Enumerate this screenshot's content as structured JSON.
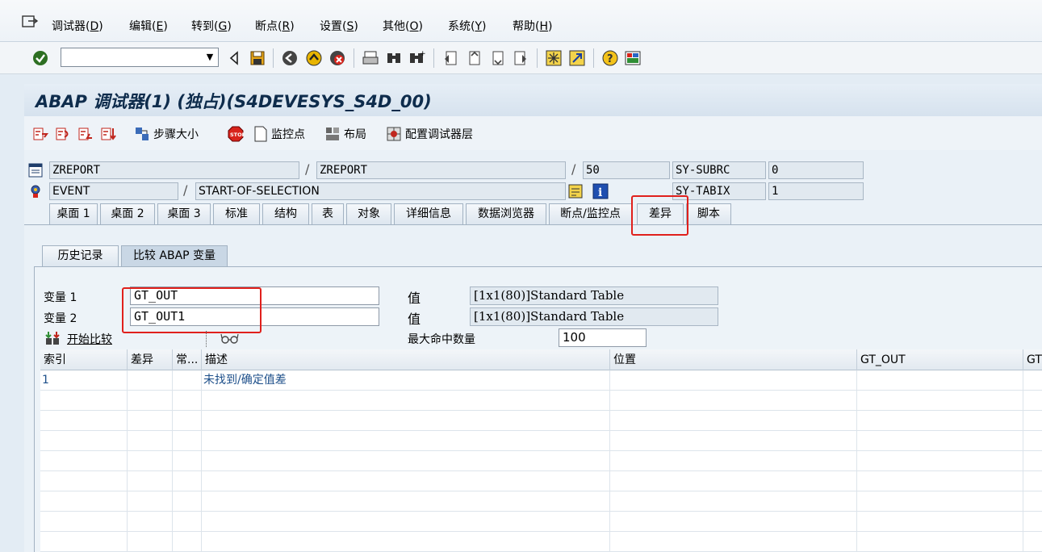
{
  "menu": [
    {
      "label": "调试器(",
      "key": "D",
      "suffix": ")"
    },
    {
      "label": "编辑(",
      "key": "E",
      "suffix": ")"
    },
    {
      "label": "转到(",
      "key": "G",
      "suffix": ")"
    },
    {
      "label": "断点(",
      "key": "R",
      "suffix": ")"
    },
    {
      "label": "设置(",
      "key": "S",
      "suffix": ")"
    },
    {
      "label": "其他(",
      "key": "O",
      "suffix": ")"
    },
    {
      "label": "系统(",
      "key": "Y",
      "suffix": ")"
    },
    {
      "label": "帮助(",
      "key": "H",
      "suffix": ")"
    }
  ],
  "title": "ABAP 调试器(1)  (独占)(S4DEVESYS_S4D_00)",
  "app_toolbar": {
    "step_size": "步骤大小",
    "watchpoint": "监控点",
    "layout": "布局",
    "configure_layers": "配置调试器层"
  },
  "info": {
    "program": "ZREPORT",
    "include": "ZREPORT",
    "line": "50",
    "sy_subrc_label": "SY-SUBRC",
    "sy_subrc_value": "0",
    "event_type": "EVENT",
    "event_name": "START-OF-SELECTION",
    "sy_tabix_label": "SY-TABIX",
    "sy_tabix_value": "1"
  },
  "tabs": [
    "桌面 1",
    "桌面 2",
    "桌面 3",
    "标准",
    "结构",
    "表",
    "对象",
    "详细信息",
    "数据浏览器",
    "断点/监控点",
    "差异",
    "脚本"
  ],
  "subtabs": [
    "历史记录",
    "比较 ABAP 变量"
  ],
  "compare": {
    "var1_label": "变量 1",
    "var1_value": "GT_OUT",
    "var2_label": "变量 2",
    "var2_value": "GT_OUT1",
    "val_label": "值",
    "val1": "[1x1(80)]Standard Table",
    "val2": "[1x1(80)]Standard Table",
    "start_compare": "开始比较",
    "max_hits_label": "最大命中数量",
    "max_hits_value": "100"
  },
  "grid": {
    "headers": [
      "索引",
      "差异",
      "常...",
      "描述",
      "位置",
      "GT_OUT",
      "GT"
    ],
    "rows": [
      [
        "1",
        "",
        "",
        "未找到/确定值差",
        "",
        "",
        ""
      ]
    ]
  }
}
